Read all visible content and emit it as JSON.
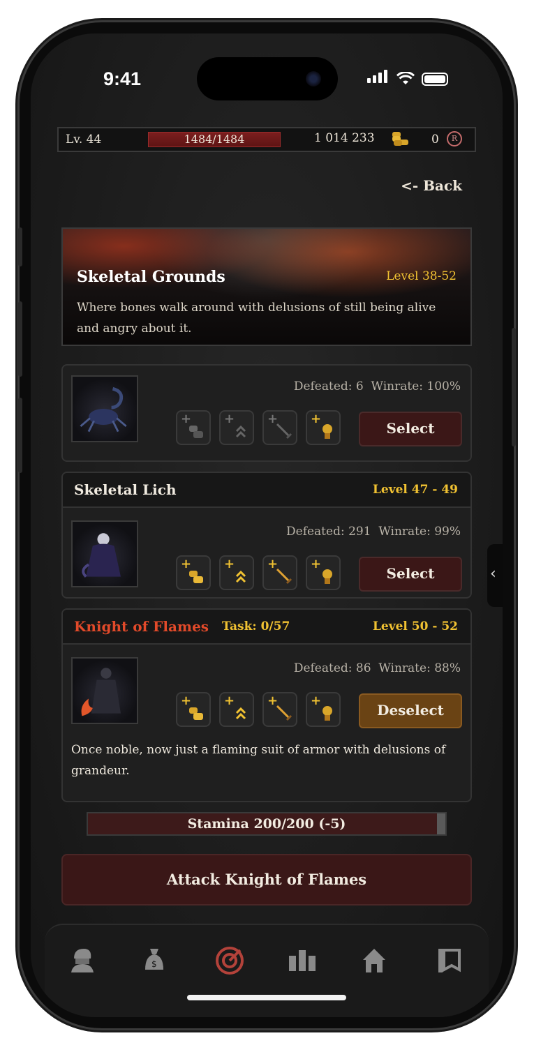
{
  "status_bar": {
    "time": "9:41"
  },
  "topbar": {
    "level": "Lv. 44",
    "hp": "1484/1484",
    "gold": "1 014 233",
    "gems": "0"
  },
  "nav": {
    "back": "<- Back"
  },
  "location": {
    "name": "Skeletal Grounds",
    "level_range": "Level 38-52",
    "description": "Where bones walk around with delusions of still being alive and angry about it."
  },
  "monsters": [
    {
      "name": "",
      "defeated": "Defeated: 6",
      "winrate": "Winrate: 100%",
      "action": "Select"
    },
    {
      "name": "Skeletal Lich",
      "level": "Level 47 - 49",
      "defeated": "Defeated: 291",
      "winrate": "Winrate: 99%",
      "action": "Select"
    },
    {
      "name": "Knight of Flames",
      "task": "Task: 0/57",
      "level": "Level 50 - 52",
      "defeated": "Defeated: 86",
      "winrate": "Winrate: 88%",
      "action": "Deselect",
      "description": "Once noble, now just a flaming suit of armor with delusions of grandeur."
    }
  ],
  "reward_icons": [
    "coins-icon",
    "rank-up-icon",
    "sword-icon",
    "medal-icon"
  ],
  "stamina": {
    "label": "Stamina 200/200 (-5)",
    "fraction": 1.0
  },
  "attack_button": "Attack Knight of Flames",
  "tabs": [
    "character-icon",
    "money-bag-icon",
    "target-icon",
    "leaderboard-icon",
    "house-icon",
    "guild-banner-icon"
  ],
  "colors": {
    "accent_gold": "#f1c232",
    "accent_red": "#e24a2a",
    "active_tab": "#b3423a"
  }
}
